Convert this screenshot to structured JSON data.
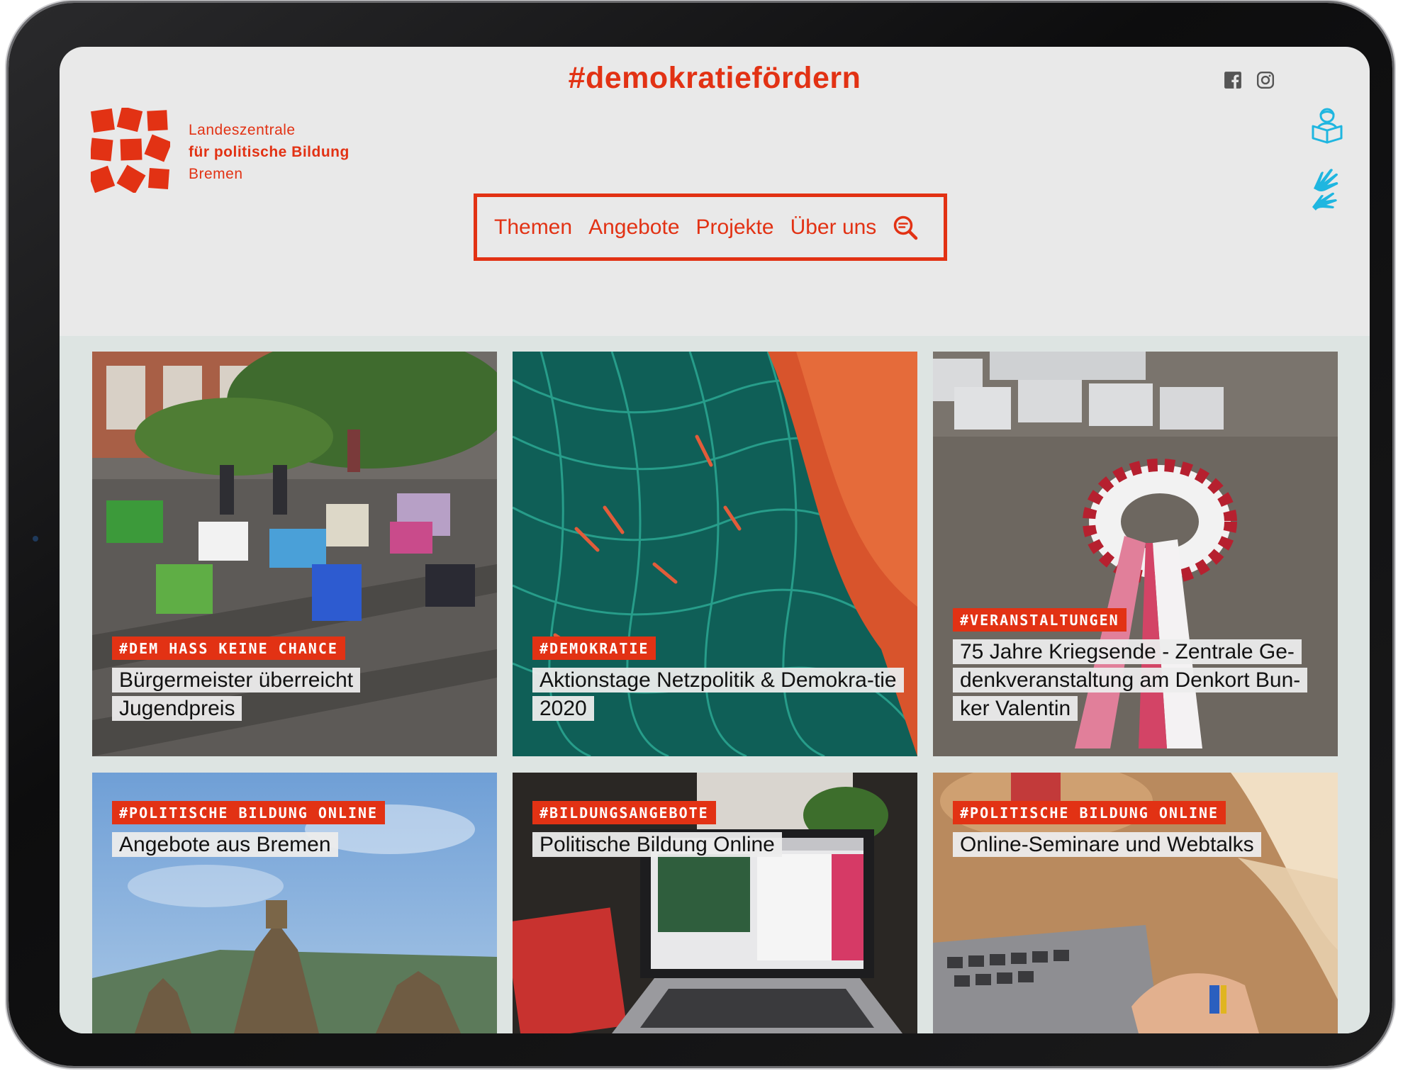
{
  "header": {
    "hashtag": "#demokratiefördern",
    "social": [
      "facebook-icon",
      "instagram-icon"
    ]
  },
  "brand": {
    "line1": "Landeszentrale",
    "line2": "für politische Bildung",
    "line3": "Bremen",
    "color": "#e23214"
  },
  "side_icons": [
    "easy-language-reader-icon",
    "sign-language-hands-icon"
  ],
  "accent_cyan": "#1fb6e0",
  "nav": {
    "items": [
      {
        "label": "Themen"
      },
      {
        "label": "Angebote"
      },
      {
        "label": "Projekte"
      },
      {
        "label": "Über uns"
      }
    ],
    "search_icon": "search-icon"
  },
  "cards": [
    {
      "tag": "#DEM HASS KEINE CHANCE",
      "title": "Bürgermeister überreicht Jugendpreis"
    },
    {
      "tag": "#DEMOKRATIE",
      "title": "Aktionstage Netzpolitik & Demokra-tie 2020"
    },
    {
      "tag": "#VERANSTALTUNGEN",
      "title": "75 Jahre Kriegsende - Zentrale Ge-denkveranstaltung am Denkort Bun-ker Valentin"
    },
    {
      "tag": "#POLITISCHE BILDUNG ONLINE",
      "title": "Angebote aus Bremen"
    },
    {
      "tag": "#BILDUNGSANGEBOTE",
      "title": "Politische Bildung Online"
    },
    {
      "tag": "#POLITISCHE BILDUNG ONLINE",
      "title": "Online-Seminare und Webtalks"
    }
  ]
}
